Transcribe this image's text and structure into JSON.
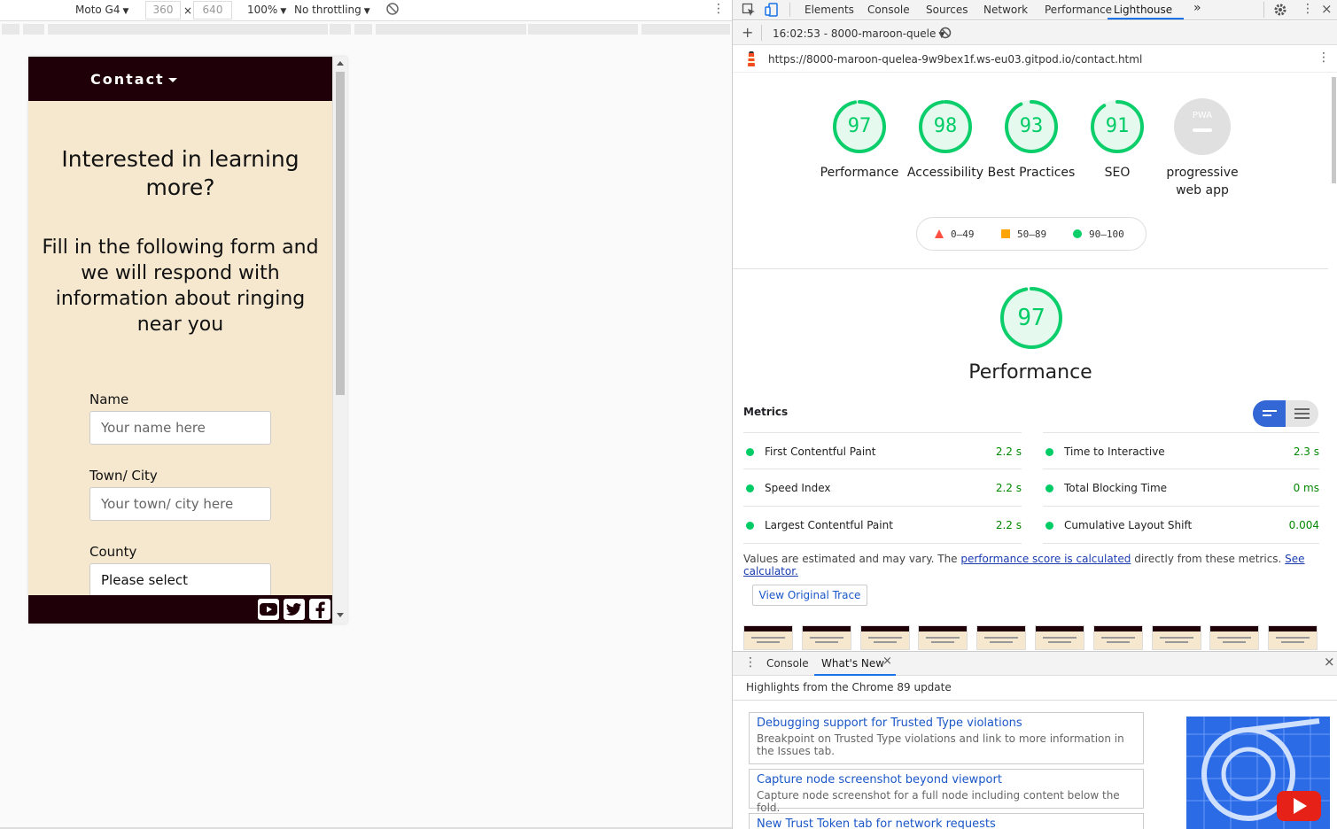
{
  "device_toolbar": {
    "device": "Moto G4",
    "width": "360",
    "times": "×",
    "height": "640",
    "zoom": "100%",
    "throttling": "No throttling"
  },
  "phone": {
    "nav_brand": "Contact",
    "title": "Interested in learning more?",
    "subtitle": "Fill in the following form and we will respond with information about ringing near you",
    "fields": [
      {
        "label": "Name",
        "placeholder": "Your name here"
      },
      {
        "label": "Town/ City",
        "placeholder": "Your town/ city here"
      },
      {
        "label": "County",
        "value": "Please select"
      }
    ],
    "social_icons": [
      "youtube-icon",
      "twitter-icon",
      "facebook-icon"
    ],
    "colors": {
      "nav": "#200008",
      "background": "#f5e8cf"
    }
  },
  "devtools": {
    "tabs": [
      "Elements",
      "Console",
      "Sources",
      "Network",
      "Performance",
      "Lighthouse"
    ],
    "active_tab": "Lighthouse",
    "more_tabs": "»",
    "report_select": "16:02:53 - 8000-maroon-quele",
    "url": "https://8000-maroon-quelea-9w9bex1f.ws-eu03.gitpod.io/contact.html"
  },
  "lighthouse": {
    "gauges": [
      {
        "score": "97",
        "label": "Performance",
        "value": 97
      },
      {
        "score": "98",
        "label": "Accessibility",
        "value": 98
      },
      {
        "score": "93",
        "label": "Best Practices",
        "value": 93
      },
      {
        "score": "91",
        "label": "SEO",
        "value": 91
      }
    ],
    "pwa": {
      "badge": "PWA",
      "label": "progressive web app"
    },
    "legend": [
      "0–49",
      "50–89",
      "90–100"
    ],
    "main_score": "97",
    "main_label": "Performance",
    "metrics_title": "Metrics",
    "metrics": [
      {
        "name": "First Contentful Paint",
        "value": "2.2 s"
      },
      {
        "name": "Time to Interactive",
        "value": "2.3 s"
      },
      {
        "name": "Speed Index",
        "value": "2.2 s"
      },
      {
        "name": "Total Blocking Time",
        "value": "0 ms"
      },
      {
        "name": "Largest Contentful Paint",
        "value": "2.2 s"
      },
      {
        "name": "Cumulative Layout Shift",
        "value": "0.004"
      }
    ],
    "note_prefix": "Values are estimated and may vary. The ",
    "note_link": "performance score is calculated",
    "note_middle": " directly from these metrics. ",
    "note_link2": "See calculator.",
    "trace_button": "View Original Trace",
    "colors": {
      "pass": "#0cce6b",
      "average": "#ffa400",
      "fail": "#ff4e42"
    }
  },
  "drawer": {
    "tabs": [
      "Console",
      "What's New"
    ],
    "active_tab": "What's New",
    "header": "Highlights from the Chrome 89 update",
    "cards": [
      {
        "title": "Debugging support for Trusted Type violations",
        "desc": "Breakpoint on Trusted Type violations and link to more information in the Issues tab."
      },
      {
        "title": "Capture node screenshot beyond viewport",
        "desc": "Capture node screenshot for a full node including content below the fold."
      },
      {
        "title": "New Trust Token tab for network requests",
        "desc": ""
      }
    ]
  }
}
